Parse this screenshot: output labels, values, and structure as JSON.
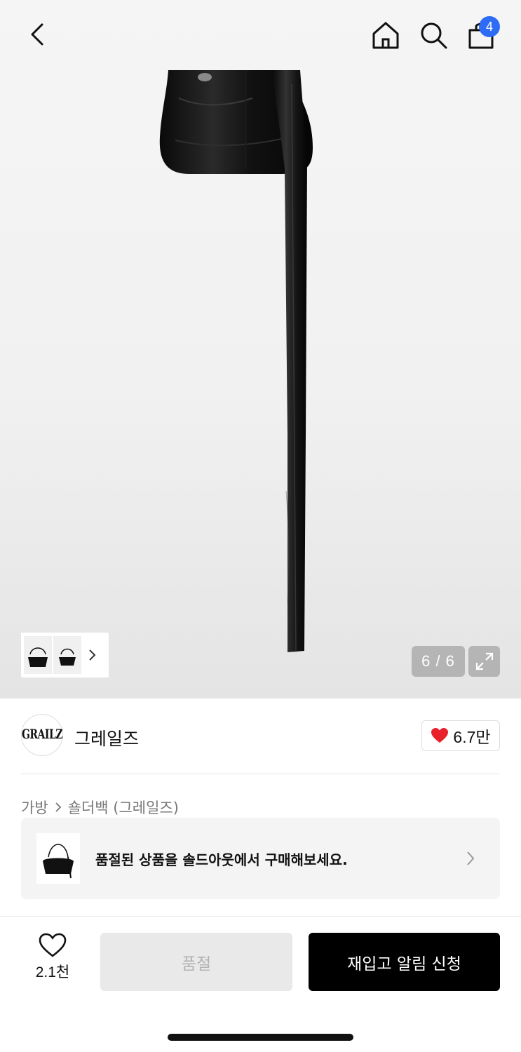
{
  "header": {
    "cart_count": "4"
  },
  "gallery": {
    "pager": "6 / 6"
  },
  "brand": {
    "logo_text": "GRAILZ",
    "name": "그레일즈",
    "likes": "6.7만"
  },
  "breadcrumb": {
    "category": "가방",
    "subcategory": "숄더백 (그레일즈)"
  },
  "soldout_banner": {
    "text": "품절된 상품을 솔드아웃에서 구매해보세요."
  },
  "bottom_bar": {
    "wish_count": "2.1천",
    "soldout_label": "품절",
    "restock_label": "재입고 알림 신청"
  },
  "colors": {
    "accent_blue": "#2f6cf6",
    "heart_red": "#e8202a",
    "primary_black": "#000000"
  }
}
